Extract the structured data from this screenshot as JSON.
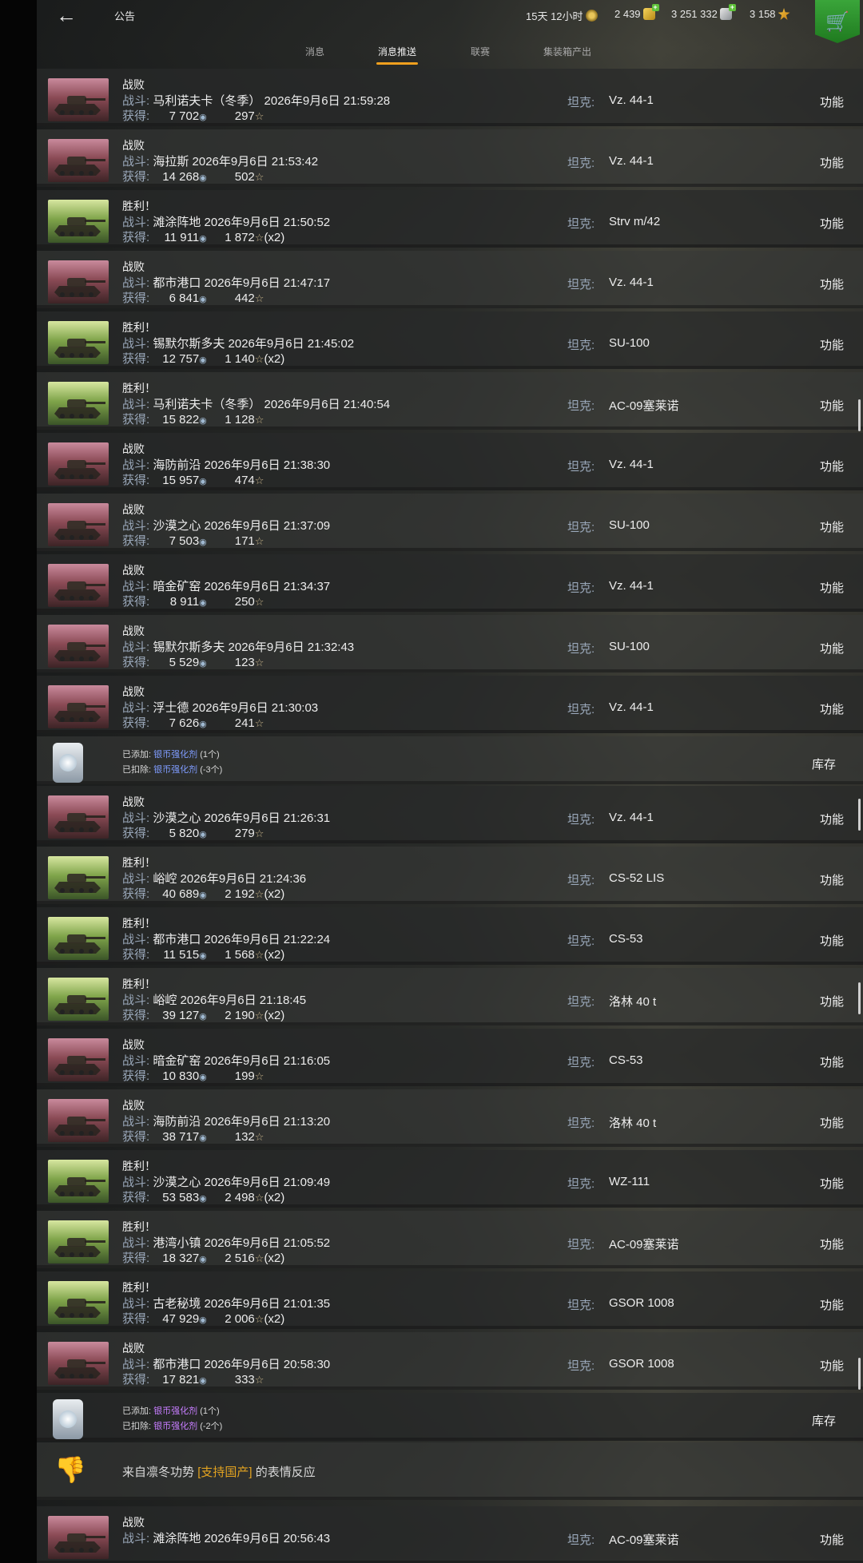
{
  "header": {
    "title": "公告",
    "premium_time": "15天 12小时",
    "gold": "2 439",
    "credits": "3 251 332",
    "free_xp": "3 158"
  },
  "tabs": [
    "消息",
    "消息推送",
    "联赛",
    "集装箱产出"
  ],
  "active_tab": "消息推送",
  "labels": {
    "battle": "战斗:",
    "earned": "获得:",
    "tank": "坦克:",
    "function": "功能",
    "inventory": "库存",
    "added": "已添加:",
    "deducted": "已扣除:",
    "booster": "银币强化剂"
  },
  "battles": [
    {
      "result": "战败",
      "map": "马利诺夫卡（冬季）",
      "time": "2026年9月6日 21:59:28",
      "credits": "7 702",
      "exp": "297",
      "mult": "",
      "tank": "Vz. 44-1"
    },
    {
      "result": "战败",
      "map": "海拉斯",
      "time": "2026年9月6日 21:53:42",
      "credits": "14 268",
      "exp": "502",
      "mult": "",
      "tank": "Vz. 44-1"
    },
    {
      "result": "胜利！",
      "map": "滩涂阵地",
      "time": "2026年9月6日 21:50:52",
      "credits": "11 911",
      "exp": "1 872",
      "mult": "(x2)",
      "tank": "Strv m/42"
    },
    {
      "result": "战败",
      "map": "都市港口",
      "time": "2026年9月6日 21:47:17",
      "credits": "6 841",
      "exp": "442",
      "mult": "",
      "tank": "Vz. 44-1"
    },
    {
      "result": "胜利！",
      "map": "锡默尔斯多夫",
      "time": "2026年9月6日 21:45:02",
      "credits": "12 757",
      "exp": "1 140",
      "mult": "(x2)",
      "tank": "SU-100"
    },
    {
      "result": "胜利！",
      "map": "马利诺夫卡（冬季）",
      "time": "2026年9月6日 21:40:54",
      "credits": "15 822",
      "exp": "1 128",
      "mult": "",
      "tank": "AC-09塞莱诺"
    },
    {
      "result": "战败",
      "map": "海防前沿",
      "time": "2026年9月6日 21:38:30",
      "credits": "15 957",
      "exp": "474",
      "mult": "",
      "tank": "Vz. 44-1"
    },
    {
      "result": "战败",
      "map": "沙漠之心",
      "time": "2026年9月6日 21:37:09",
      "credits": "7 503",
      "exp": "171",
      "mult": "",
      "tank": "SU-100"
    },
    {
      "result": "战败",
      "map": "暗金矿窑",
      "time": "2026年9月6日 21:34:37",
      "credits": "8 911",
      "exp": "250",
      "mult": "",
      "tank": "Vz. 44-1"
    },
    {
      "result": "战败",
      "map": "锡默尔斯多夫",
      "time": "2026年9月6日 21:32:43",
      "credits": "5 529",
      "exp": "123",
      "mult": "",
      "tank": "SU-100"
    },
    {
      "result": "战败",
      "map": "浮士德",
      "time": "2026年9月6日 21:30:03",
      "credits": "7 626",
      "exp": "241",
      "mult": "",
      "tank": "Vz. 44-1"
    },
    {
      "result": "战败",
      "map": "沙漠之心",
      "time": "2026年9月6日 21:26:31",
      "credits": "5 820",
      "exp": "279",
      "mult": "",
      "tank": "Vz. 44-1"
    },
    {
      "result": "胜利！",
      "map": "峪崆",
      "time": "2026年9月6日 21:24:36",
      "credits": "40 689",
      "exp": "2 192",
      "mult": "(x2)",
      "tank": "CS-52 LIS"
    },
    {
      "result": "胜利！",
      "map": "都市港口",
      "time": "2026年9月6日 21:22:24",
      "credits": "11 515",
      "exp": "1 568",
      "mult": "(x2)",
      "tank": "CS-53"
    },
    {
      "result": "胜利！",
      "map": "峪崆",
      "time": "2026年9月6日 21:18:45",
      "credits": "39 127",
      "exp": "2 190",
      "mult": "(x2)",
      "tank": "洛林 40 t"
    },
    {
      "result": "战败",
      "map": "暗金矿窑",
      "time": "2026年9月6日 21:16:05",
      "credits": "10 830",
      "exp": "199",
      "mult": "",
      "tank": "CS-53"
    },
    {
      "result": "战败",
      "map": "海防前沿",
      "time": "2026年9月6日 21:13:20",
      "credits": "38 717",
      "exp": "132",
      "mult": "",
      "tank": "洛林 40 t"
    },
    {
      "result": "胜利！",
      "map": "沙漠之心",
      "time": "2026年9月6日 21:09:49",
      "credits": "53 583",
      "exp": "2 498",
      "mult": "(x2)",
      "tank": "WZ-111"
    },
    {
      "result": "胜利！",
      "map": "港湾小镇",
      "time": "2026年9月6日 21:05:52",
      "credits": "18 327",
      "exp": "2 516",
      "mult": "(x2)",
      "tank": "AC-09塞莱诺"
    },
    {
      "result": "胜利！",
      "map": "古老秘境",
      "time": "2026年9月6日 21:01:35",
      "credits": "47 929",
      "exp": "2 006",
      "mult": "(x2)",
      "tank": "GSOR 1008"
    },
    {
      "result": "战败",
      "map": "都市港口",
      "time": "2026年9月6日 20:58:30",
      "credits": "17 821",
      "exp": "333",
      "mult": "",
      "tank": "GSOR 1008"
    },
    {
      "result": "战败",
      "map": "滩涂阵地",
      "time": "2026年9月6日 20:56:43",
      "credits": "",
      "exp": "",
      "mult": "",
      "tank": "AC-09塞莱诺"
    }
  ],
  "boosters": [
    {
      "added": "(1个)",
      "deducted": "(-3个)"
    },
    {
      "added": "(1个)",
      "deducted": "(-2个)"
    }
  ],
  "reaction": {
    "prefix": "来自凛冬功势",
    "tag": "[支持国产]",
    "suffix": "的表情反应"
  }
}
